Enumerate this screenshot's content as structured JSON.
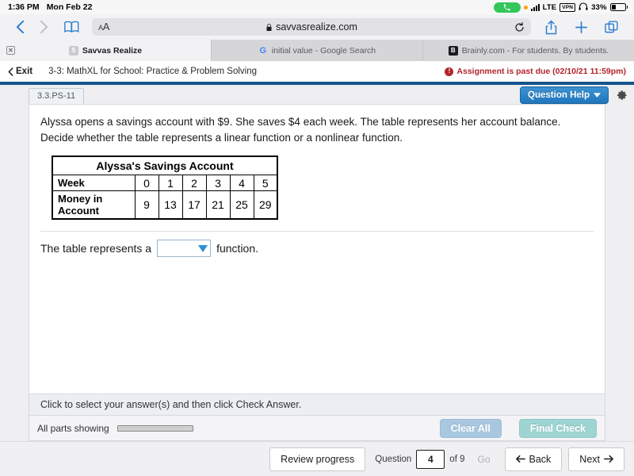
{
  "status_bar": {
    "time": "1:36 PM",
    "date": "Mon Feb 22",
    "call_icon": "phone-icon",
    "recording_dot": "orange-dot-icon",
    "signal_icon": "signal-bars-icon",
    "network": "LTE",
    "vpn_badge": "VPN",
    "headphones_icon": "headphones-icon",
    "battery_percent": "33%",
    "battery_level": 33
  },
  "browser": {
    "back_icon": "chevron-left-icon",
    "forward_icon": "chevron-right-icon",
    "bookmarks_icon": "book-icon",
    "text_size_small": "A",
    "text_size_large": "A",
    "lock_icon": "lock-icon",
    "url": "savvasrealize.com",
    "reload_icon": "reload-icon",
    "share_icon": "share-icon",
    "new_tab_icon": "plus-icon",
    "tabs_icon": "tabs-overview-icon",
    "tabs": [
      {
        "title": "Savvas Realize",
        "favicon": "savvas-s-icon",
        "favicon_letter": "S",
        "active": true,
        "close_icon": "close-icon"
      },
      {
        "title": "initial value - Google Search",
        "favicon": "google-g-icon",
        "favicon_letter": "G",
        "active": false
      },
      {
        "title": "Brainly.com - For students. By students.",
        "favicon": "brainly-b-icon",
        "favicon_letter": "B",
        "active": false
      }
    ]
  },
  "assignment_header": {
    "exit_label": "Exit",
    "exit_icon": "chevron-left-icon",
    "title": "3-3: MathXL for School: Practice & Problem Solving",
    "past_due_icon": "alert-exclamation-icon",
    "past_due_text": "Assignment is past due (02/10/21 11:59pm)",
    "past_due_color": "#b3242b"
  },
  "exercise": {
    "question_tab": "3.3.PS-11",
    "question_help_label": "Question Help",
    "question_help_caret": "chevron-down-icon",
    "settings_icon": "gear-icon",
    "accent_blue": "#1f76bd",
    "problem_text": "Alyssa opens a savings account with $9. She saves $4 each week. The table represents her account balance. Decide whether the table represents a linear function or a nonlinear function.",
    "table": {
      "caption": "Alyssa's Savings Account",
      "rows": [
        {
          "label": "Week",
          "values": [
            "0",
            "1",
            "2",
            "3",
            "4",
            "5"
          ]
        },
        {
          "label": "Money in Account",
          "values": [
            "9",
            "13",
            "17",
            "21",
            "25",
            "29"
          ]
        }
      ]
    },
    "answer": {
      "prefix": "The table represents a",
      "dropdown_value": "",
      "dropdown_caret": "caret-down-icon",
      "suffix": "function."
    },
    "hint_text": "Click to select your answer(s) and then click Check Answer.",
    "parts_label": "All parts showing",
    "parts_progress_percent": 100,
    "clear_all_label": "Clear All",
    "final_check_label": "Final Check"
  },
  "bottom_nav": {
    "review_progress_label": "Review progress",
    "question_label": "Question",
    "question_value": "4",
    "of_label": "of 9",
    "go_label": "Go",
    "back_label": "Back",
    "back_icon": "arrow-left-icon",
    "next_label": "Next",
    "next_icon": "arrow-right-icon"
  }
}
